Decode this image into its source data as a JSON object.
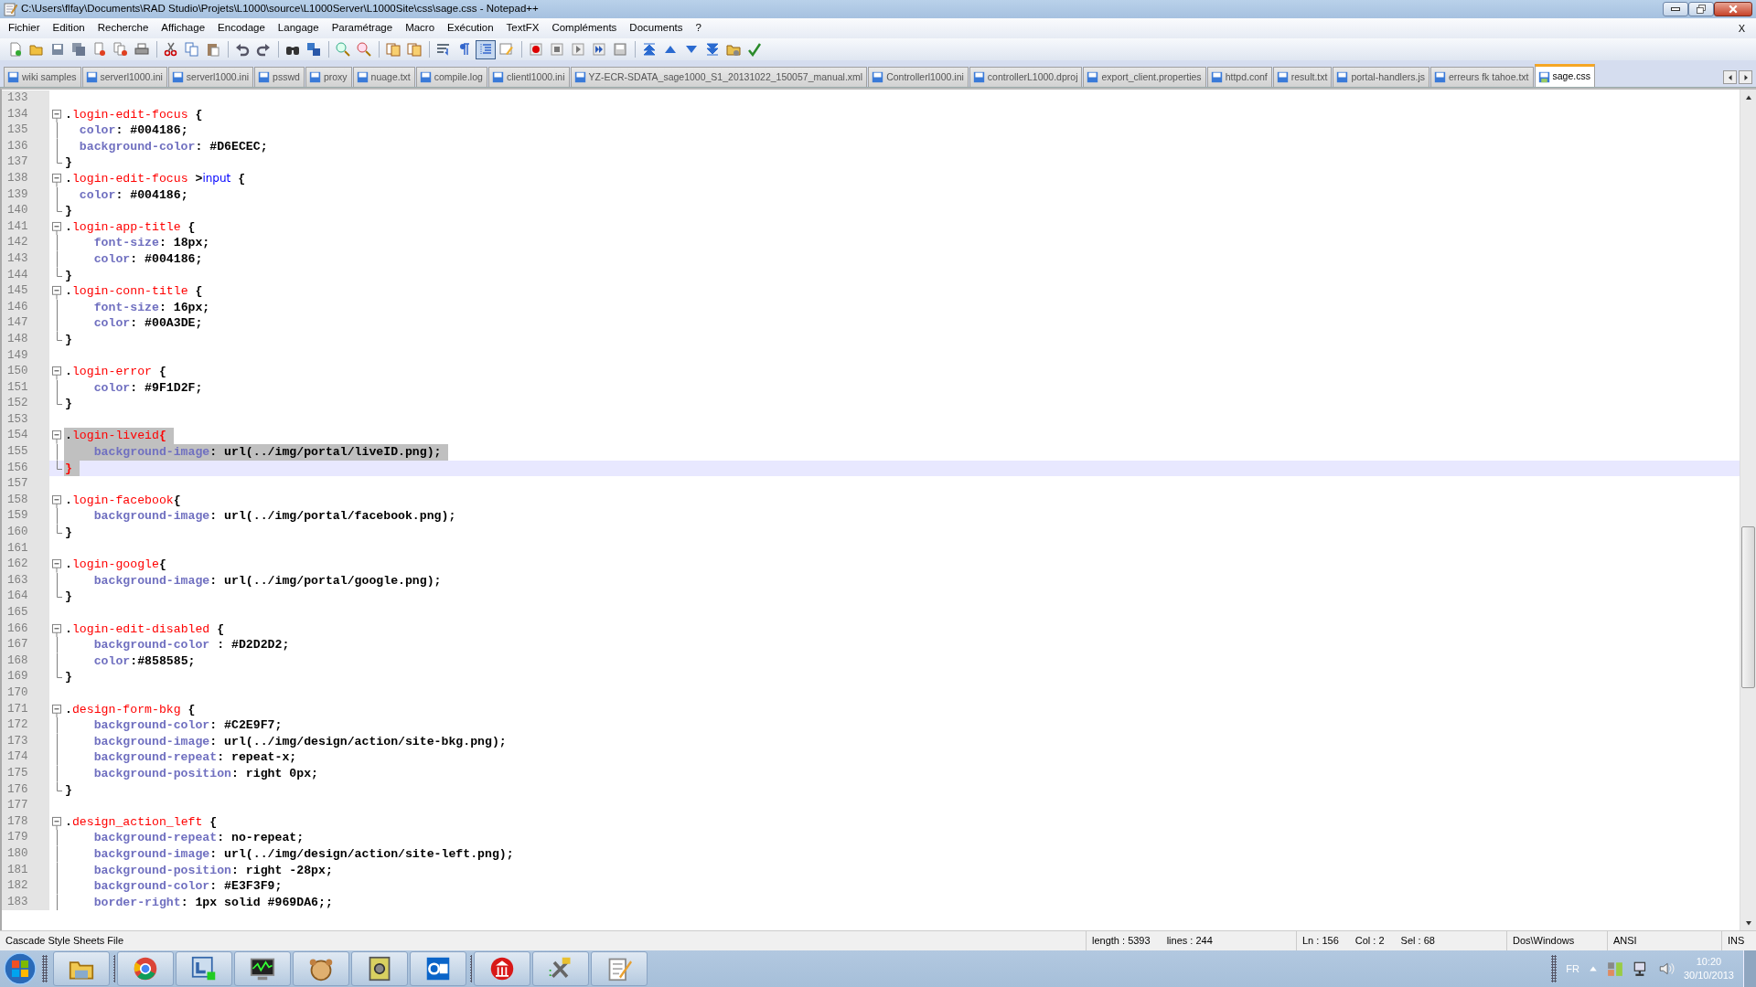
{
  "window": {
    "title": "C:\\Users\\flfay\\Documents\\RAD Studio\\Projets\\L1000\\source\\L1000Server\\L1000Site\\css\\sage.css - Notepad++"
  },
  "menu": [
    "Fichier",
    "Edition",
    "Recherche",
    "Affichage",
    "Encodage",
    "Langage",
    "Paramétrage",
    "Macro",
    "Exécution",
    "TextFX",
    "Compléments",
    "Documents",
    "?"
  ],
  "menu_close": "X",
  "toolbar": [
    {
      "pressed": false
    },
    {
      "pressed": false
    },
    {
      "pressed": false
    },
    {
      "pressed": false
    },
    {
      "pressed": false
    },
    {
      "pressed": false
    },
    {
      "pressed": false
    },
    {
      "pressed": false
    },
    {
      "pressed": false
    },
    {
      "pressed": false
    },
    {
      "pressed": false
    },
    {
      "pressed": false
    },
    {
      "pressed": false
    },
    {
      "pressed": false
    },
    {
      "pressed": false
    },
    {
      "pressed": false
    },
    {
      "pressed": false
    },
    {
      "pressed": false
    },
    {
      "pressed": false
    },
    {
      "pressed": false
    },
    {
      "pressed": true
    },
    {
      "pressed": false
    },
    {
      "pressed": false
    },
    {
      "pressed": false
    },
    {
      "pressed": false
    },
    {
      "pressed": false
    },
    {
      "pressed": false
    },
    {
      "pressed": false
    },
    {
      "pressed": false
    },
    {
      "pressed": false
    },
    {
      "pressed": false
    },
    {
      "pressed": false
    },
    {
      "pressed": false
    }
  ],
  "tabs": [
    {
      "label": "wiki samples",
      "selected": false
    },
    {
      "label": "serverl1000.ini",
      "selected": false
    },
    {
      "label": "serverl1000.ini",
      "selected": false
    },
    {
      "label": "psswd",
      "selected": false
    },
    {
      "label": "proxy",
      "selected": false
    },
    {
      "label": "nuage.txt",
      "selected": false
    },
    {
      "label": "compile.log",
      "selected": false
    },
    {
      "label": "clientl1000.ini",
      "selected": false
    },
    {
      "label": "YZ-ECR-SDATA_sage1000_S1_20131022_150057_manual.xml",
      "selected": false
    },
    {
      "label": "Controllerl1000.ini",
      "selected": false
    },
    {
      "label": "controllerL1000.dproj",
      "selected": false
    },
    {
      "label": "export_client.properties",
      "selected": false
    },
    {
      "label": "httpd.conf",
      "selected": false
    },
    {
      "label": "result.txt",
      "selected": false
    },
    {
      "label": "portal-handlers.js",
      "selected": false
    },
    {
      "label": "erreurs fk tahoe.txt",
      "selected": false
    },
    {
      "label": "sage.css",
      "selected": true
    }
  ],
  "editor": {
    "lines": [
      {
        "number": "133",
        "kind": "plain"
      },
      {
        "number": "134",
        "kind": "block-start",
        "tokens": [
          {
            "kind": "op",
            "text": "."
          },
          {
            "kind": "sel",
            "text": "login-edit-focus"
          },
          {
            "kind": "op",
            "text": " {"
          }
        ]
      },
      {
        "number": "135",
        "kind": "block-body",
        "tokens": [
          {
            "kind": "prop",
            "text": "  color"
          },
          {
            "kind": "val",
            "text": ": #004186;"
          }
        ]
      },
      {
        "number": "136",
        "kind": "block-body",
        "tokens": [
          {
            "kind": "prop",
            "text": "  background-color"
          },
          {
            "kind": "val",
            "text": ": #D6ECEC;"
          }
        ]
      },
      {
        "number": "137",
        "kind": "block-end",
        "tokens": [
          {
            "kind": "op",
            "text": "}"
          }
        ]
      },
      {
        "number": "138",
        "kind": "block-start",
        "tokens": [
          {
            "kind": "op",
            "text": "."
          },
          {
            "kind": "sel",
            "text": "login-edit-focus"
          },
          {
            "kind": "op",
            "text": " >"
          },
          {
            "kind": "tag",
            "text": "input"
          },
          {
            "kind": "op",
            "text": " {"
          }
        ]
      },
      {
        "number": "139",
        "kind": "block-body",
        "tokens": [
          {
            "kind": "prop",
            "text": "  color"
          },
          {
            "kind": "val",
            "text": ": #004186;"
          }
        ]
      },
      {
        "number": "140",
        "kind": "block-end",
        "tokens": [
          {
            "kind": "op",
            "text": "}"
          }
        ]
      },
      {
        "number": "141",
        "kind": "block-start",
        "tokens": [
          {
            "kind": "op",
            "text": "."
          },
          {
            "kind": "sel",
            "text": "login-app-title"
          },
          {
            "kind": "op",
            "text": " {"
          }
        ]
      },
      {
        "number": "142",
        "kind": "block-body",
        "tokens": [
          {
            "kind": "prop",
            "text": "    font-size"
          },
          {
            "kind": "val",
            "text": ": 18px;"
          }
        ]
      },
      {
        "number": "143",
        "kind": "block-body",
        "tokens": [
          {
            "kind": "prop",
            "text": "    color"
          },
          {
            "kind": "val",
            "text": ": #004186;"
          }
        ]
      },
      {
        "number": "144",
        "kind": "block-end",
        "tokens": [
          {
            "kind": "op",
            "text": "}"
          }
        ]
      },
      {
        "number": "145",
        "kind": "block-start",
        "tokens": [
          {
            "kind": "op",
            "text": "."
          },
          {
            "kind": "sel",
            "text": "login-conn-title"
          },
          {
            "kind": "op",
            "text": " {"
          }
        ]
      },
      {
        "number": "146",
        "kind": "block-body",
        "tokens": [
          {
            "kind": "prop",
            "text": "    font-size"
          },
          {
            "kind": "val",
            "text": ": 16px;"
          }
        ]
      },
      {
        "number": "147",
        "kind": "block-body",
        "tokens": [
          {
            "kind": "prop",
            "text": "    color"
          },
          {
            "kind": "val",
            "text": ": #00A3DE;"
          }
        ]
      },
      {
        "number": "148",
        "kind": "block-end",
        "tokens": [
          {
            "kind": "op",
            "text": "}"
          }
        ]
      },
      {
        "number": "149",
        "kind": "plain"
      },
      {
        "number": "150",
        "kind": "block-start",
        "tokens": [
          {
            "kind": "op",
            "text": "."
          },
          {
            "kind": "sel",
            "text": "login-error"
          },
          {
            "kind": "op",
            "text": " {"
          }
        ]
      },
      {
        "number": "151",
        "kind": "block-body",
        "tokens": [
          {
            "kind": "prop",
            "text": "    color"
          },
          {
            "kind": "val",
            "text": ": #9F1D2F;"
          }
        ]
      },
      {
        "number": "152",
        "kind": "block-end",
        "tokens": [
          {
            "kind": "op",
            "text": "}"
          }
        ]
      },
      {
        "number": "153",
        "kind": "plain"
      },
      {
        "number": "154",
        "kind": "block-start",
        "selected": true,
        "tokens": [
          {
            "kind": "op",
            "text": "."
          },
          {
            "kind": "sel",
            "text": "login-liveid"
          },
          {
            "kind": "match",
            "text": "{"
          }
        ]
      },
      {
        "number": "155",
        "kind": "block-body",
        "selected": true,
        "tokens": [
          {
            "kind": "prop",
            "text": "    background-image"
          },
          {
            "kind": "val",
            "text": ": url(../img/portal/liveID.png);"
          }
        ]
      },
      {
        "number": "156",
        "kind": "block-end",
        "selected": true,
        "current": true,
        "tokens": [
          {
            "kind": "match",
            "text": "}"
          }
        ]
      },
      {
        "number": "157",
        "kind": "plain"
      },
      {
        "number": "158",
        "kind": "block-start",
        "tokens": [
          {
            "kind": "op",
            "text": "."
          },
          {
            "kind": "sel",
            "text": "login-facebook"
          },
          {
            "kind": "op",
            "text": "{"
          }
        ]
      },
      {
        "number": "159",
        "kind": "block-body",
        "tokens": [
          {
            "kind": "prop",
            "text": "    background-image"
          },
          {
            "kind": "val",
            "text": ": url(../img/portal/facebook.png);"
          }
        ]
      },
      {
        "number": "160",
        "kind": "block-end",
        "tokens": [
          {
            "kind": "op",
            "text": "}"
          }
        ]
      },
      {
        "number": "161",
        "kind": "plain"
      },
      {
        "number": "162",
        "kind": "block-start",
        "tokens": [
          {
            "kind": "op",
            "text": "."
          },
          {
            "kind": "sel",
            "text": "login-google"
          },
          {
            "kind": "op",
            "text": "{"
          }
        ]
      },
      {
        "number": "163",
        "kind": "block-body",
        "tokens": [
          {
            "kind": "prop",
            "text": "    background-image"
          },
          {
            "kind": "val",
            "text": ": url(../img/portal/google.png);"
          }
        ]
      },
      {
        "number": "164",
        "kind": "block-end",
        "tokens": [
          {
            "kind": "op",
            "text": "}"
          }
        ]
      },
      {
        "number": "165",
        "kind": "plain"
      },
      {
        "number": "166",
        "kind": "block-start",
        "tokens": [
          {
            "kind": "op",
            "text": "."
          },
          {
            "kind": "sel",
            "text": "login-edit-disabled"
          },
          {
            "kind": "op",
            "text": " {"
          }
        ]
      },
      {
        "number": "167",
        "kind": "block-body",
        "tokens": [
          {
            "kind": "prop",
            "text": "    background-color"
          },
          {
            "kind": "val",
            "text": " : #D2D2D2;"
          }
        ]
      },
      {
        "number": "168",
        "kind": "block-body",
        "tokens": [
          {
            "kind": "prop",
            "text": "    color"
          },
          {
            "kind": "val",
            "text": ":#858585;"
          }
        ]
      },
      {
        "number": "169",
        "kind": "block-end",
        "tokens": [
          {
            "kind": "op",
            "text": "}"
          }
        ]
      },
      {
        "number": "170",
        "kind": "plain"
      },
      {
        "number": "171",
        "kind": "block-start",
        "tokens": [
          {
            "kind": "op",
            "text": "."
          },
          {
            "kind": "sel",
            "text": "design-form-bkg"
          },
          {
            "kind": "op",
            "text": " {"
          }
        ]
      },
      {
        "number": "172",
        "kind": "block-body",
        "tokens": [
          {
            "kind": "prop",
            "text": "    background-color"
          },
          {
            "kind": "val",
            "text": ": #C2E9F7;"
          }
        ]
      },
      {
        "number": "173",
        "kind": "block-body",
        "tokens": [
          {
            "kind": "prop",
            "text": "    background-image"
          },
          {
            "kind": "val",
            "text": ": url(../img/design/action/site-bkg.png);"
          }
        ]
      },
      {
        "number": "174",
        "kind": "block-body",
        "tokens": [
          {
            "kind": "prop",
            "text": "    background-repeat"
          },
          {
            "kind": "val",
            "text": ": repeat-x;"
          }
        ]
      },
      {
        "number": "175",
        "kind": "block-body",
        "tokens": [
          {
            "kind": "prop",
            "text": "    background-position"
          },
          {
            "kind": "val",
            "text": ": right 0px;"
          }
        ]
      },
      {
        "number": "176",
        "kind": "block-end",
        "tokens": [
          {
            "kind": "op",
            "text": "}"
          }
        ]
      },
      {
        "number": "177",
        "kind": "plain"
      },
      {
        "number": "178",
        "kind": "block-start",
        "tokens": [
          {
            "kind": "op",
            "text": "."
          },
          {
            "kind": "sel",
            "text": "design_action_left"
          },
          {
            "kind": "op",
            "text": " {"
          }
        ]
      },
      {
        "number": "179",
        "kind": "block-body",
        "tokens": [
          {
            "kind": "prop",
            "text": "    background-repeat"
          },
          {
            "kind": "val",
            "text": ": no-repeat;"
          }
        ]
      },
      {
        "number": "180",
        "kind": "block-body",
        "tokens": [
          {
            "kind": "prop",
            "text": "    background-image"
          },
          {
            "kind": "val",
            "text": ": url(../img/design/action/site-left.png);"
          }
        ]
      },
      {
        "number": "181",
        "kind": "block-body",
        "tokens": [
          {
            "kind": "prop",
            "text": "    background-position"
          },
          {
            "kind": "val",
            "text": ": right -28px;"
          }
        ]
      },
      {
        "number": "182",
        "kind": "block-body",
        "tokens": [
          {
            "kind": "prop",
            "text": "    background-color"
          },
          {
            "kind": "val",
            "text": ": #E3F3F9;"
          }
        ]
      },
      {
        "number": "183",
        "kind": "block-body",
        "tokens": [
          {
            "kind": "prop",
            "text": "    border-right"
          },
          {
            "kind": "val",
            "text": ": 1px solid #969DA6;;"
          }
        ]
      }
    ]
  },
  "status_bar": {
    "file_type": "Cascade Style Sheets File",
    "length": "length : 5393",
    "lines": "lines : 244",
    "ln": "Ln : 156",
    "col": "Col : 2",
    "sel": "Sel : 68",
    "eol": "Dos\\Windows",
    "encoding": "ANSI",
    "mode": "INS"
  },
  "taskbar": {
    "language": "FR",
    "time": "10:20",
    "date": "30/10/2013"
  }
}
